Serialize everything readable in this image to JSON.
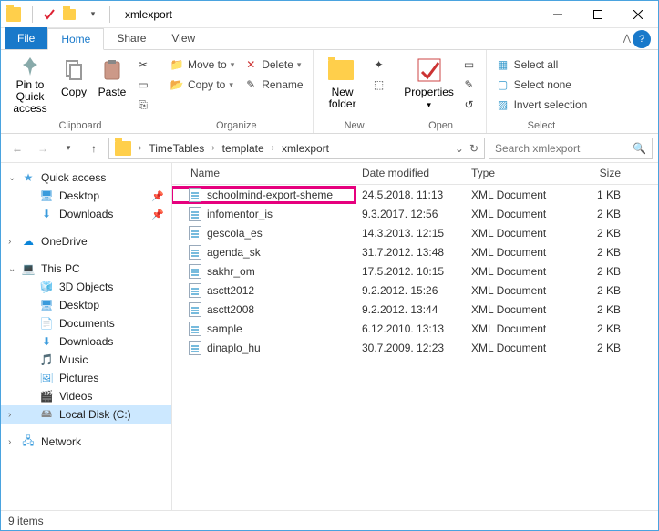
{
  "window": {
    "title": "xmlexport"
  },
  "tabs": {
    "file": "File",
    "home": "Home",
    "share": "Share",
    "view": "View"
  },
  "ribbon": {
    "clipboard": {
      "label": "Clipboard",
      "pin": "Pin to Quick access",
      "copy": "Copy",
      "paste": "Paste"
    },
    "organize": {
      "label": "Organize",
      "move": "Move to",
      "copy": "Copy to",
      "delete": "Delete",
      "rename": "Rename"
    },
    "new_group": {
      "label": "New",
      "newfolder": "New folder"
    },
    "open_group": {
      "label": "Open",
      "properties": "Properties"
    },
    "select_group": {
      "label": "Select",
      "all": "Select all",
      "none": "Select none",
      "invert": "Invert selection"
    }
  },
  "breadcrumbs": {
    "items": [
      "TimeTables",
      "template",
      "xmlexport"
    ]
  },
  "search": {
    "placeholder": "Search xmlexport"
  },
  "nav": {
    "quick": "Quick access",
    "desktop": "Desktop",
    "downloads": "Downloads",
    "onedrive": "OneDrive",
    "thispc": "This PC",
    "obj3d": "3D Objects",
    "desktop2": "Desktop",
    "documents": "Documents",
    "downloads2": "Downloads",
    "music": "Music",
    "pictures": "Pictures",
    "videos": "Videos",
    "cdrive": "Local Disk (C:)",
    "network": "Network"
  },
  "columns": {
    "name": "Name",
    "date": "Date modified",
    "type": "Type",
    "size": "Size"
  },
  "files": [
    {
      "name": "schoolmind-export-sheme",
      "date": "24.5.2018. 11:13",
      "type": "XML Document",
      "size": "1 KB",
      "hl": true
    },
    {
      "name": "infomentor_is",
      "date": "9.3.2017. 12:56",
      "type": "XML Document",
      "size": "2 KB"
    },
    {
      "name": "gescola_es",
      "date": "14.3.2013. 12:15",
      "type": "XML Document",
      "size": "2 KB"
    },
    {
      "name": "agenda_sk",
      "date": "31.7.2012. 13:48",
      "type": "XML Document",
      "size": "2 KB"
    },
    {
      "name": "sakhr_om",
      "date": "17.5.2012. 10:15",
      "type": "XML Document",
      "size": "2 KB"
    },
    {
      "name": "asctt2012",
      "date": "9.2.2012. 15:26",
      "type": "XML Document",
      "size": "2 KB"
    },
    {
      "name": "asctt2008",
      "date": "9.2.2012. 13:44",
      "type": "XML Document",
      "size": "2 KB"
    },
    {
      "name": "sample",
      "date": "6.12.2010. 13:13",
      "type": "XML Document",
      "size": "2 KB"
    },
    {
      "name": "dinaplo_hu",
      "date": "30.7.2009. 12:23",
      "type": "XML Document",
      "size": "2 KB"
    }
  ],
  "status": {
    "count": "9 items"
  }
}
